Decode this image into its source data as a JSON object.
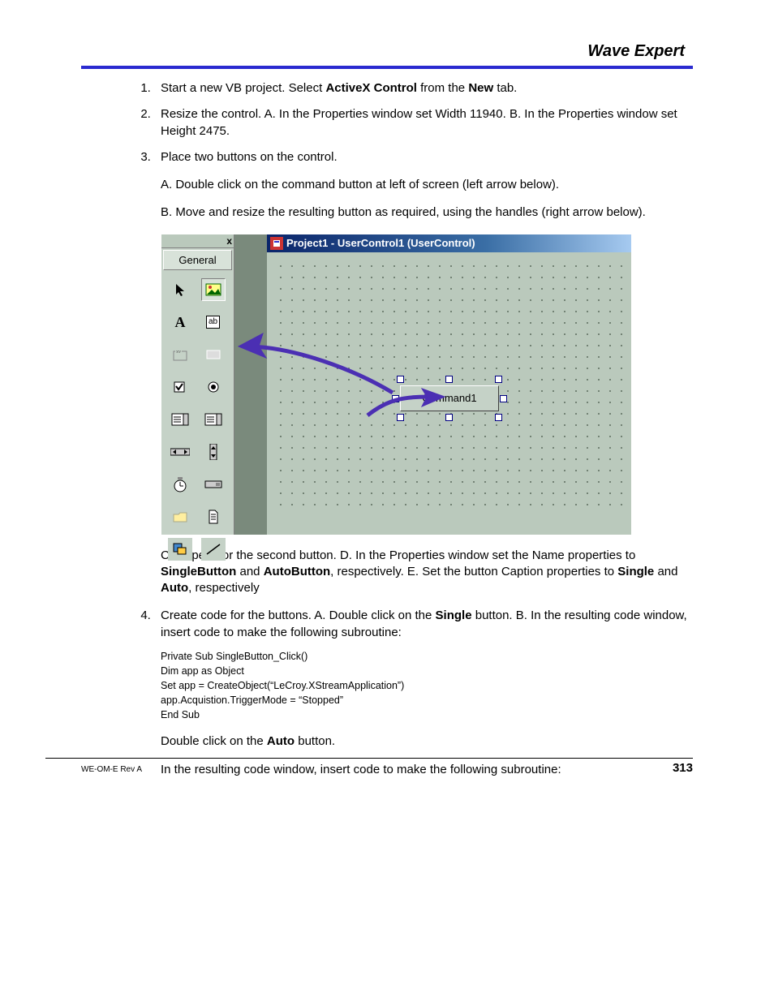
{
  "header": {
    "title": "Wave Expert"
  },
  "steps": {
    "s1": {
      "pre": "Start a new VB project. Select ",
      "b1": "ActiveX Control",
      "mid": " from the ",
      "b2": "New",
      "post": " tab."
    },
    "s2": "Resize the control. A. In the Properties window set Width 11940. B. In the Properties window set Height 2475.",
    "s3": {
      "main": "Place two buttons on the control.",
      "a": "A. Double click on the command button at left of screen (left arrow below).",
      "b": "B. Move and resize the resulting button as required, using the handles (right arrow below).",
      "c": {
        "pre": "C. Repeat for the second button. D. In the Properties window set the Name properties to ",
        "b1": "SingleButton",
        "mid1": " and ",
        "b2": "AutoButton",
        "mid2": ", respectively. E. Set the button Caption properties to ",
        "b3": "Single",
        "mid3": " and ",
        "b4": "Auto",
        "post": ", respectively"
      }
    },
    "s4": {
      "pre": "Create code for the buttons. A. Double click on the ",
      "b1": "Single",
      "post": " button. B. In the resulting code window, insert code to make the following subroutine:",
      "code": "Private Sub SingleButton_Click()\nDim app as Object\nSet app = CreateObject(“LeCroy.XStreamApplication”)\napp.Acquistion.TriggerMode = “Stopped”\nEnd Sub",
      "after1_pre": "Double click on the ",
      "after1_b": "Auto",
      "after1_post": " button.",
      "after2": "In the resulting code window, insert code to make the following subroutine:"
    }
  },
  "vb": {
    "toolbox_tab": "General",
    "close_x": "x",
    "form_title": "Project1 - UserControl1 (UserControl)",
    "cmd_label": "Command1",
    "tool_A": "A",
    "tool_ab": "ab"
  },
  "footer": {
    "left": "WE-OM-E Rev A",
    "right": "313"
  }
}
